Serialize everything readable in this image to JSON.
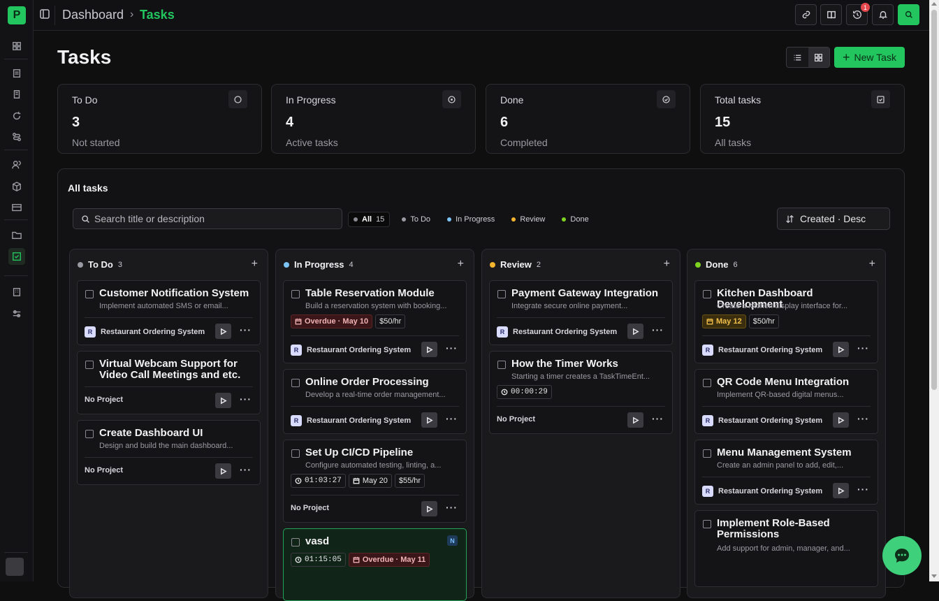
{
  "app": {
    "logo_letter": "P"
  },
  "breadcrumb": {
    "root": "Dashboard",
    "separator": "›",
    "current": "Tasks"
  },
  "topbar": {
    "notification_count": "1"
  },
  "page": {
    "title": "Tasks",
    "new_task_label": "New Task"
  },
  "stats": [
    {
      "label": "To Do",
      "value": "3",
      "sub": "Not started",
      "icon": "circle-icon"
    },
    {
      "label": "In Progress",
      "value": "4",
      "sub": "Active tasks",
      "icon": "target-icon"
    },
    {
      "label": "Done",
      "value": "6",
      "sub": "Completed",
      "icon": "check-circle-icon"
    },
    {
      "label": "Total tasks",
      "value": "15",
      "sub": "All tasks",
      "icon": "check-square-icon"
    }
  ],
  "panel": {
    "title": "All tasks",
    "search_placeholder": "Search title or description",
    "filters": [
      {
        "label": "All",
        "count": "15",
        "color": "#8a8a92"
      },
      {
        "label": "To Do",
        "color": "#9a9aa2"
      },
      {
        "label": "In Progress",
        "color": "#7cc4f5"
      },
      {
        "label": "Review",
        "color": "#f5b52e"
      },
      {
        "label": "Done",
        "color": "#7ed321"
      }
    ],
    "sort_label": "Created · Desc"
  },
  "columns": [
    {
      "name": "To Do",
      "count": "3",
      "color": "#9a9aa2",
      "cards": [
        {
          "title": "Customer Notification System",
          "desc": "Implement automated SMS or email...",
          "project": "Restaurant Ordering System"
        },
        {
          "title": "Virtual Webcam Support for Video Call Meetings and etc.",
          "project": "No Project"
        },
        {
          "title": "Create Dashboard UI",
          "desc": "Design and build the main dashboard...",
          "project": "No Project"
        }
      ]
    },
    {
      "name": "In Progress",
      "count": "4",
      "color": "#7cc4f5",
      "cards": [
        {
          "title": "Table Reservation Module",
          "desc": "Build a reservation system with booking...",
          "overdue": "Overdue · May 10",
          "rate": "$50/hr",
          "project": "Restaurant Ordering System"
        },
        {
          "title": "Online Order Processing",
          "desc": "Develop a real-time order management...",
          "project": "Restaurant Ordering System"
        },
        {
          "title": "Set Up CI/CD Pipeline",
          "desc": "Configure automated testing, linting, a...",
          "timer": "01:03:27",
          "date": "May 20",
          "rate": "$55/hr",
          "project": "No Project"
        },
        {
          "title": "vasd",
          "badge": "N",
          "timer": "01:15:05",
          "overdue": "Overdue · May 11"
        }
      ]
    },
    {
      "name": "Review",
      "count": "2",
      "color": "#f5b52e",
      "cards": [
        {
          "title": "Payment Gateway Integration",
          "desc": "Integrate secure online payment...",
          "project": "Restaurant Ordering System"
        },
        {
          "title": "How the Timer Works",
          "desc": "Starting a timer creates a TaskTimeEnt...",
          "timer": "00:00:29",
          "project": "No Project"
        }
      ]
    },
    {
      "name": "Done",
      "count": "6",
      "color": "#7ed321",
      "cards": [
        {
          "title": "Kitchen Dashboard Development",
          "desc": "Create a kitchen display interface for...",
          "date": "May 12",
          "rate": "$50/hr",
          "project": "Restaurant Ordering System"
        },
        {
          "title": "QR Code Menu Integration",
          "desc": "Implement QR-based digital menus...",
          "project": "Restaurant Ordering System"
        },
        {
          "title": "Menu Management System",
          "desc": "Create an admin panel to add, edit,...",
          "project": "Restaurant Ordering System"
        },
        {
          "title": "Implement Role-Based Permissions",
          "desc": "Add support for admin, manager, and..."
        }
      ]
    }
  ],
  "colors": {
    "accent": "#22c55e",
    "danger": "#e5484d"
  }
}
